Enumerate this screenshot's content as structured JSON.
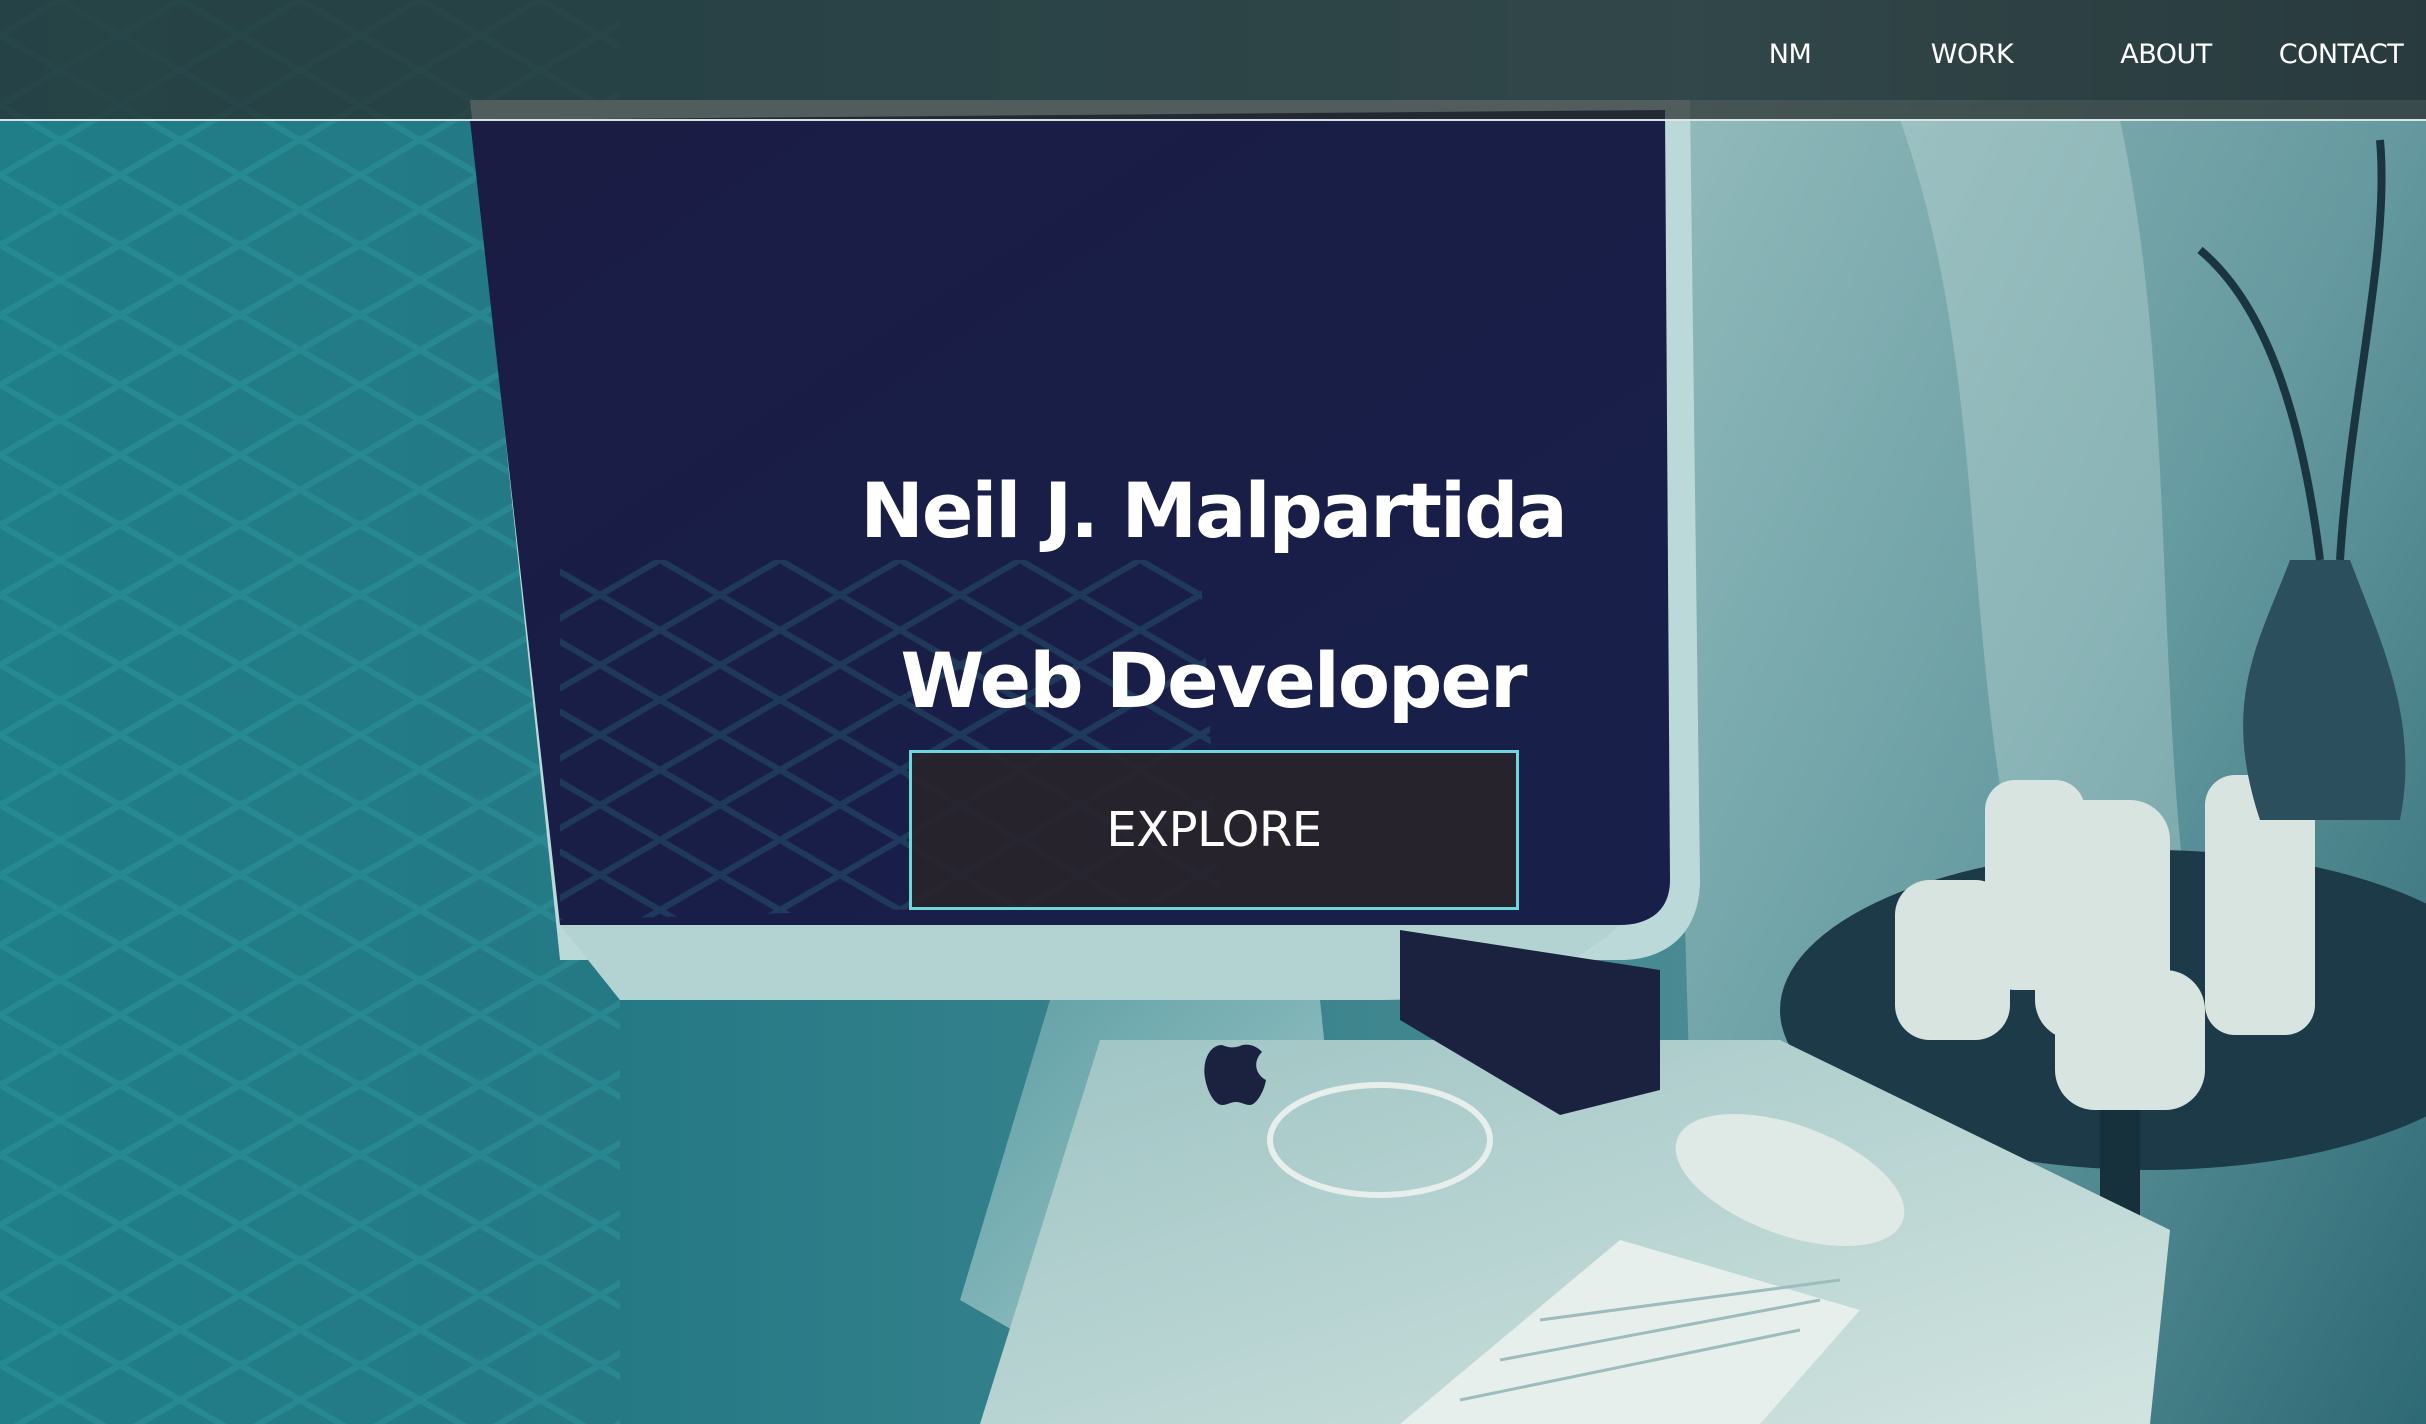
{
  "nav": {
    "items": [
      {
        "label": "NM"
      },
      {
        "label": "WORK"
      },
      {
        "label": "ABOUT"
      },
      {
        "label": "CONTACT"
      }
    ]
  },
  "hero": {
    "name": "Neil J. Malpartida",
    "role": "Web Developer",
    "cta_label": "EXPLORE"
  },
  "colors": {
    "accent_border": "#6fd6d9",
    "overlay_teal": "#1b6f7a",
    "navbar_bg": "#282c2c",
    "text": "#ffffff"
  },
  "icons": {
    "logo": "apple-logo-icon"
  }
}
